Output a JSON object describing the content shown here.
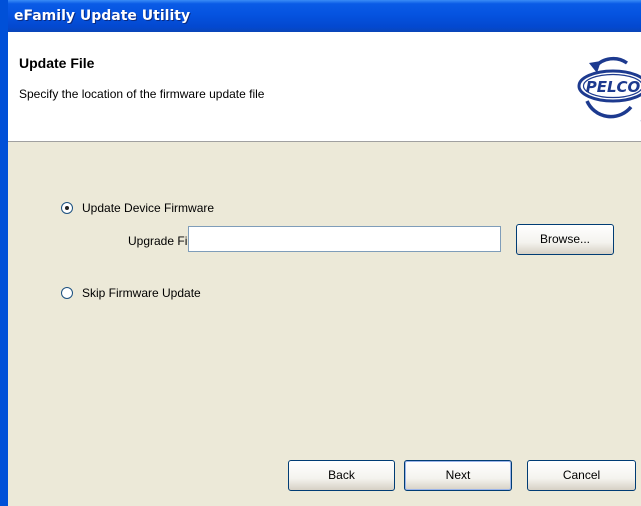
{
  "window": {
    "title": "eFamily Update Utility"
  },
  "header": {
    "title": "Update File",
    "subtitle": "Specify the location of the firmware update file",
    "logo_text": "PELCO",
    "logo_mark": "®"
  },
  "options": {
    "update_firmware_label": "Update Device Firmware",
    "update_firmware_selected": true,
    "upgrade_file_label": "Upgrade File:",
    "upgrade_file_value": "",
    "browse_label": "Browse...",
    "skip_update_label": "Skip Firmware Update",
    "skip_update_selected": false
  },
  "footer": {
    "back_label": "Back",
    "next_label": "Next",
    "cancel_label": "Cancel"
  },
  "colors": {
    "titlebar": "#0553e0",
    "content_bg": "#ece9d8",
    "logo": "#1d3a8f"
  }
}
